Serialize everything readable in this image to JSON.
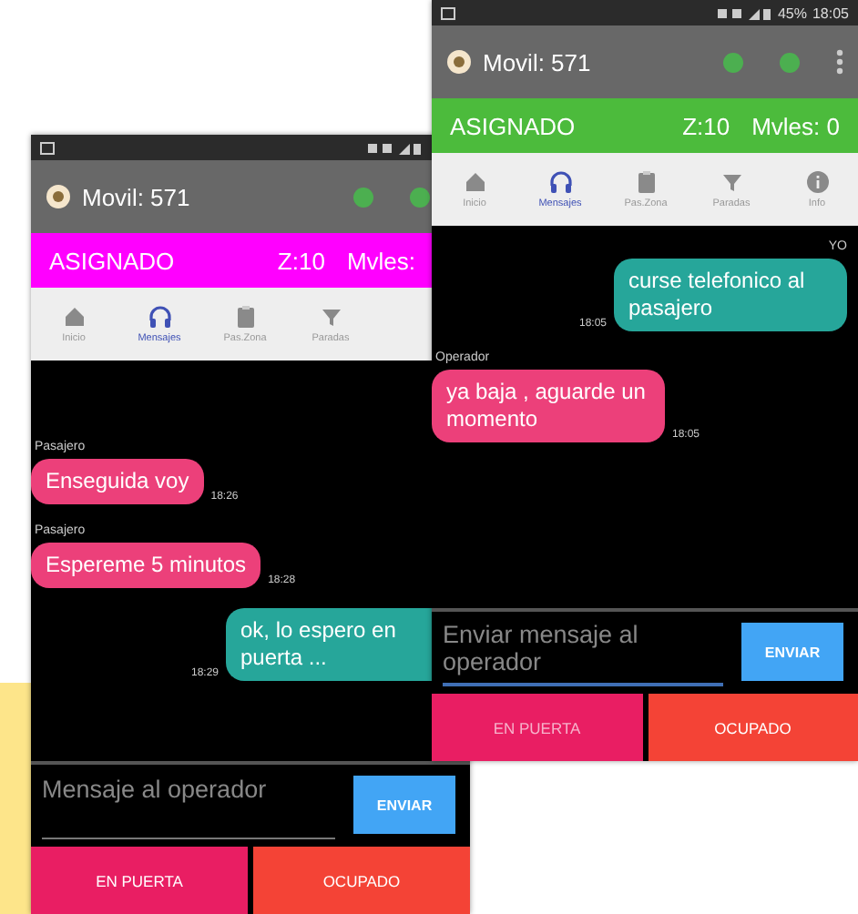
{
  "phones": [
    {
      "header": {
        "title": "Movil: 571"
      },
      "status_strip": {
        "state": "ASIGNADO",
        "color": "#ff00ff",
        "zone": "Z:10",
        "mobiles": "Mvles:"
      },
      "tabs": [
        {
          "kind": "home",
          "label": "Inicio",
          "selected": false
        },
        {
          "kind": "headphones",
          "label": "Mensajes",
          "selected": true
        },
        {
          "kind": "clipboard",
          "label": "Pas.Zona",
          "selected": false
        },
        {
          "kind": "filter",
          "label": "Paradas",
          "selected": false
        }
      ],
      "messages": [
        {
          "kind": "incoming",
          "sender": "Pasajero",
          "text": "Enseguida voy",
          "time": "18:26"
        },
        {
          "kind": "incoming",
          "sender": "Pasajero",
          "text": "Espereme 5 minutos",
          "time": "18:28"
        },
        {
          "kind": "outgoing",
          "text": "ok, lo espero en puerta ...",
          "time": "18:29"
        }
      ],
      "input": {
        "placeholder": "Mensaje al operador",
        "focused": false
      },
      "send_button": "ENVIAR",
      "actions": [
        {
          "label": "EN PUERTA",
          "color": "#e91e63",
          "disabled": false
        },
        {
          "label": "OCUPADO",
          "color": "#f44336",
          "disabled": false
        }
      ]
    },
    {
      "status_bar": {
        "battery": "45%",
        "time": "18:05"
      },
      "header": {
        "title": "Movil: 571",
        "menu": true
      },
      "status_strip": {
        "state": "ASIGNADO",
        "color": "#4cbb3c",
        "zone": "Z:10",
        "mobiles": "Mvles: 0"
      },
      "tabs": [
        {
          "kind": "home",
          "label": "Inicio",
          "selected": false
        },
        {
          "kind": "headphones",
          "label": "Mensajes",
          "selected": true
        },
        {
          "kind": "clipboard",
          "label": "Pas.Zona",
          "selected": false
        },
        {
          "kind": "filter",
          "label": "Paradas",
          "selected": false
        },
        {
          "kind": "info",
          "label": "Info",
          "selected": false
        }
      ],
      "messages": [
        {
          "kind": "outgoing",
          "sender": "YO",
          "text": "curse telefonico al pasajero",
          "time": "18:05"
        },
        {
          "kind": "incoming",
          "sender": "Operador",
          "text": "ya baja , aguarde un momento",
          "time": "18:05"
        }
      ],
      "input": {
        "placeholder": "Enviar mensaje al operador",
        "focused": true
      },
      "send_button": "ENVIAR",
      "actions": [
        {
          "label": "EN PUERTA",
          "color": "#e91e63",
          "disabled": true
        },
        {
          "label": "OCUPADO",
          "color": "#f44336",
          "disabled": false
        }
      ]
    }
  ]
}
